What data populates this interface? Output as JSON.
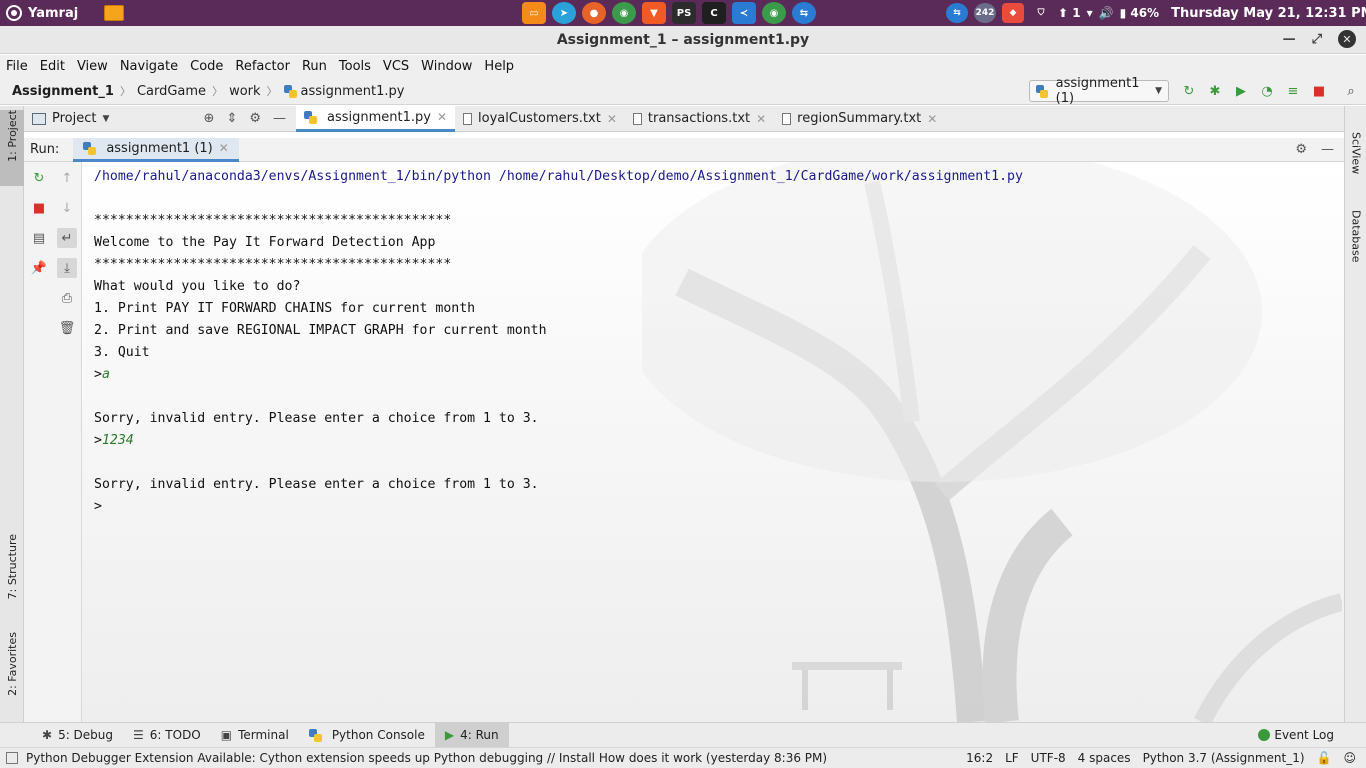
{
  "system": {
    "user": "Yamraj",
    "battery": "46%",
    "clock": "Thursday May 21, 12:31 PM",
    "notif_count": "242",
    "update_count": "1",
    "launcher_icons": [
      "files-icon",
      "telegram-icon",
      "firefox-icon",
      "chrome-icon",
      "brave-icon",
      "phpstorm-icon",
      "clion-icon",
      "vscode-icon",
      "chrome-alt-icon",
      "teamviewer-icon"
    ]
  },
  "window": {
    "title": "Assignment_1 – assignment1.py"
  },
  "menu": [
    "File",
    "Edit",
    "View",
    "Navigate",
    "Code",
    "Refactor",
    "Run",
    "Tools",
    "VCS",
    "Window",
    "Help"
  ],
  "breadcrumb": {
    "project": "Assignment_1",
    "folder1": "CardGame",
    "folder2": "work",
    "file": "assignment1.py"
  },
  "run_config": "assignment1 (1)",
  "project_tab": "Project",
  "editor_tabs": [
    {
      "label": "assignment1.py"
    },
    {
      "label": "loyalCustomers.txt"
    },
    {
      "label": "transactions.txt"
    },
    {
      "label": "regionSummary.txt"
    }
  ],
  "left_stripe": {
    "project": "1: Project",
    "structure": "7: Structure",
    "favorites": "2: Favorites"
  },
  "right_stripe": {
    "sciview": "SciView",
    "database": "Database"
  },
  "run_panel": {
    "label": "Run:",
    "tab": "assignment1 (1)"
  },
  "console": {
    "command": "/home/rahul/anaconda3/envs/Assignment_1/bin/python /home/rahul/Desktop/demo/Assignment_1/CardGame/work/assignment1.py",
    "stars": "*********************************************",
    "welcome": "Welcome to the Pay It Forward Detection App",
    "question": "What would you like to do?",
    "opt1": "1. Print PAY IT FORWARD CHAINS for current month",
    "opt2": "2. Print and save REGIONAL IMPACT GRAPH for current month",
    "opt3": "3. Quit",
    "prompt": ">",
    "input1": "a",
    "error": "Sorry, invalid entry. Please enter a choice from 1 to 3.",
    "input2": "1234"
  },
  "bottom_tools": {
    "debug": "5: Debug",
    "todo": "6: TODO",
    "terminal": "Terminal",
    "python_console": "Python Console",
    "run": "4: Run",
    "event_log": "Event Log"
  },
  "status": {
    "message": "Python Debugger Extension Available: Cython extension speeds up Python debugging // Install   How does it work (yesterday 8:36 PM)",
    "position": "16:2",
    "line_sep": "LF",
    "encoding": "UTF-8",
    "indent": "4 spaces",
    "interpreter": "Python 3.7 (Assignment_1)"
  },
  "colors": {
    "system_bar": "#5a2b59",
    "tab_underline": "#4a88c7",
    "console_path": "#1a1a8c",
    "console_input": "#2c7a2c"
  }
}
